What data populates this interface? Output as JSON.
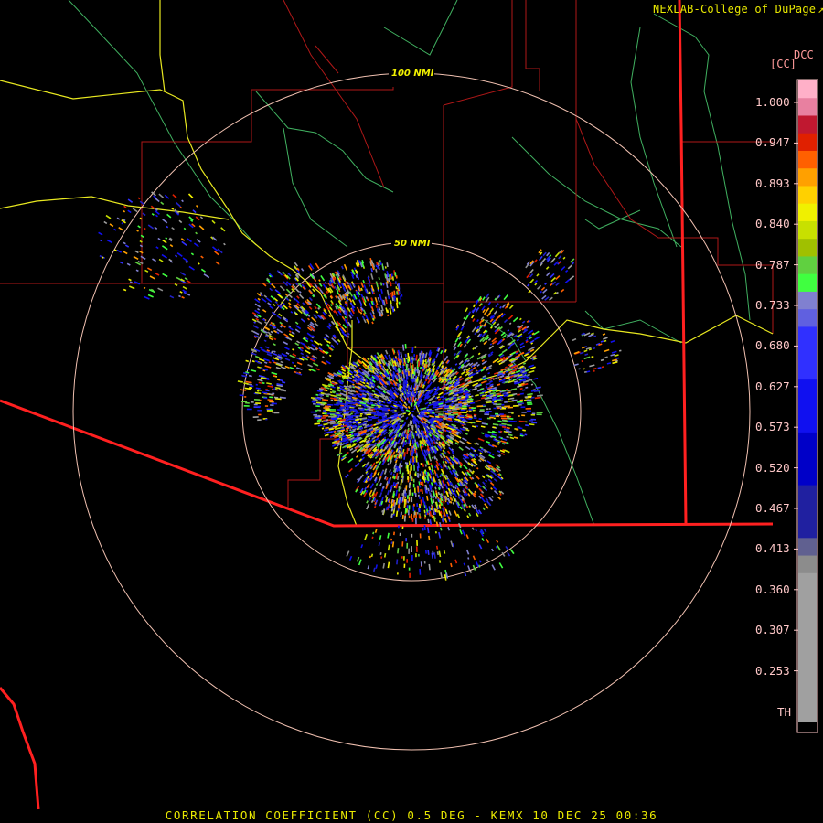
{
  "credit": {
    "text": "NEXLAB-College of DuPage",
    "icon": "external-link-icon"
  },
  "units": {
    "product": "DCC",
    "bracket": "[CC]"
  },
  "range_rings": [
    {
      "label": "50 NMI"
    },
    {
      "label": "100 NMI"
    }
  ],
  "colorbar": {
    "ticks": [
      "1.000",
      "0.947",
      "0.893",
      "0.840",
      "0.787",
      "0.733",
      "0.680",
      "0.627",
      "0.573",
      "0.520",
      "0.467",
      "0.413",
      "0.360",
      "0.307",
      "0.253",
      "TH"
    ],
    "colors": [
      "#ffb0c8",
      "#e880a0",
      "#c01830",
      "#e02000",
      "#ff6000",
      "#ffa000",
      "#ffd000",
      "#f0f000",
      "#c8e000",
      "#a0c000",
      "#60d040",
      "#40ff40",
      "#8080d0",
      "#6060e0",
      "#3030ff",
      "#1010f0",
      "#0000c8",
      "#2020a0",
      "#606090",
      "#8c8c8c",
      "#a0a0a0"
    ]
  },
  "footer": {
    "title": "CORRELATION COEFFICIENT (CC) 0.5 DEG - KEMX 10 DEC 25 00:36"
  },
  "colors": {
    "background": "#000000",
    "state_border": "#ff2020",
    "county": "#c02020",
    "highway": "#e8e820",
    "river": "#40b060",
    "ring": "#f0c0b0"
  }
}
